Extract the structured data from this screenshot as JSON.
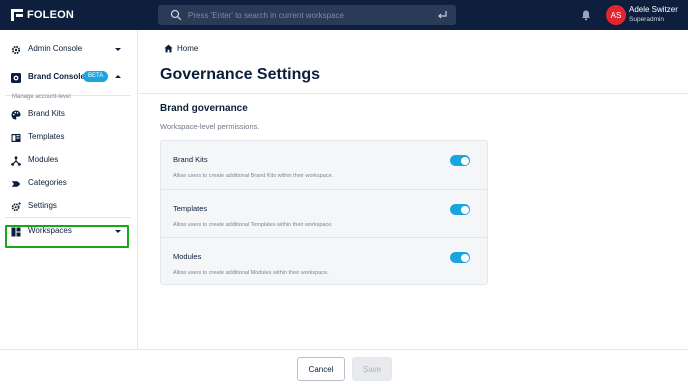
{
  "topbar": {
    "logo_text": "FOLEON",
    "search_placeholder": "Press 'Enter' to search in current workspace",
    "user_initials": "AS",
    "user_name": "Adele Switzer",
    "user_role": "Superadmin",
    "avatar_color": "#e3262d"
  },
  "sidebar": {
    "admin_console": "Admin Console",
    "brand_console": "Brand Console",
    "beta_badge": "BETA",
    "section_label": "Manage account-level",
    "items": [
      {
        "label": "Brand Kits",
        "icon": "palette-icon"
      },
      {
        "label": "Templates",
        "icon": "templates-icon"
      },
      {
        "label": "Modules",
        "icon": "modules-icon"
      },
      {
        "label": "Categories",
        "icon": "tag-icon"
      },
      {
        "label": "Settings",
        "icon": "gear-icon"
      }
    ],
    "workspaces": "Workspaces"
  },
  "main": {
    "breadcrumb": "Home",
    "title": "Governance Settings",
    "section_title": "Brand governance",
    "section_subtitle": "Workspace-level permissions.",
    "permissions": [
      {
        "name": "Brand Kits",
        "description": "Allow users to create additional Brand Kits within their workspace.",
        "enabled": true
      },
      {
        "name": "Templates",
        "description": "Allow users to create additional Templates within their workspace.",
        "enabled": true
      },
      {
        "name": "Modules",
        "description": "Allow users to create additional Modules within their workspace.",
        "enabled": true
      }
    ]
  },
  "footer": {
    "cancel_label": "Cancel",
    "save_label": "Save"
  },
  "colors": {
    "topbar_bg": "#0d1f3d",
    "accent": "#1aa5e0",
    "selection_outline": "#16a81a"
  }
}
